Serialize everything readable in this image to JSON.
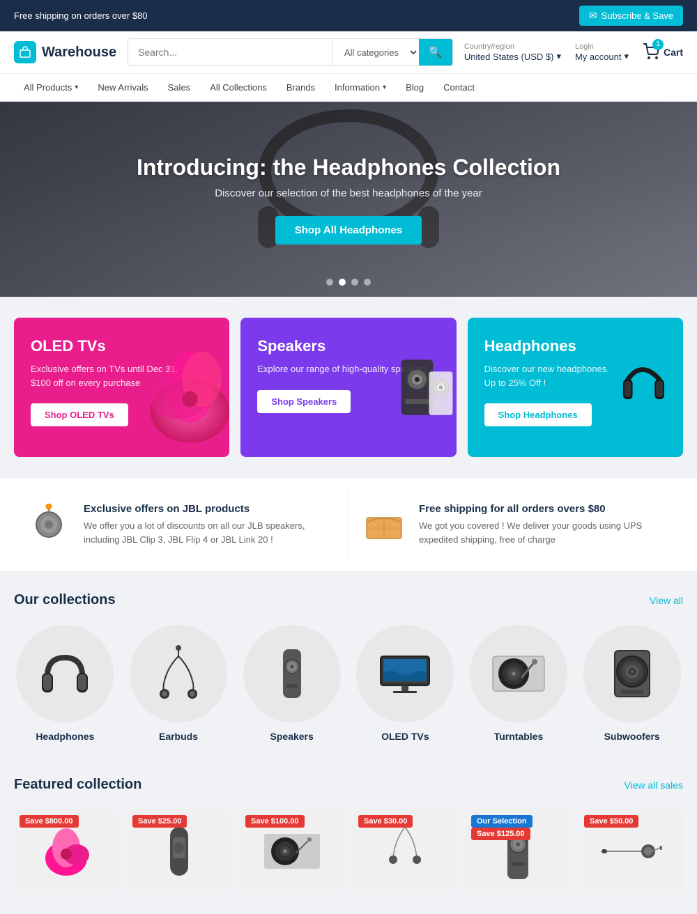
{
  "topbar": {
    "shipping_text": "Free shipping on orders over $80",
    "subscribe_label": "Subscribe & Save"
  },
  "header": {
    "logo_text": "Warehouse",
    "search_placeholder": "Search...",
    "search_category_label": "All categories",
    "country_label": "Country/region",
    "country_value": "United States (USD $)",
    "login_label": "Login",
    "account_label": "My account",
    "cart_count": "1",
    "cart_label": "Cart"
  },
  "nav": {
    "items": [
      {
        "label": "All Products",
        "has_dropdown": true
      },
      {
        "label": "New Arrivals",
        "has_dropdown": false
      },
      {
        "label": "Sales",
        "has_dropdown": false
      },
      {
        "label": "All Collections",
        "has_dropdown": false
      },
      {
        "label": "Brands",
        "has_dropdown": false
      },
      {
        "label": "Information",
        "has_dropdown": true
      },
      {
        "label": "Blog",
        "has_dropdown": false
      },
      {
        "label": "Contact",
        "has_dropdown": false
      }
    ]
  },
  "hero": {
    "title": "Introducing: the Headphones Collection",
    "subtitle": "Discover our selection of the best headphones of the year",
    "cta_label": "Shop All Headphones",
    "dots": [
      1,
      2,
      3,
      4
    ],
    "active_dot": 2
  },
  "promo_cards": [
    {
      "id": "oled",
      "theme": "pink",
      "title": "OLED TVs",
      "description": "Exclusive offers on TVs until Dec 31.\n$100 off on every purchase",
      "btn_label": "Shop OLED TVs"
    },
    {
      "id": "speakers",
      "theme": "purple",
      "title": "Speakers",
      "description": "Explore our range of high-quality speakers.",
      "btn_label": "Shop Speakers"
    },
    {
      "id": "headphones",
      "theme": "cyan",
      "title": "Headphones",
      "description": "Discover our new headphones.\nUp to 25% Off !",
      "btn_label": "Shop Headphones"
    }
  ],
  "info_banners": [
    {
      "id": "jbl",
      "icon": "🔊",
      "title": "Exclusive offers on JBL products",
      "description": "We offer you a lot of discounts on all our JLB speakers, including JBL Clip 3, JBL Flip 4 or JBL Link 20 !"
    },
    {
      "id": "shipping",
      "icon": "📦",
      "title": "Free shipping for all orders overs $80",
      "description": "We got you covered ! We deliver your goods using UPS expedited shipping, free of charge"
    }
  ],
  "collections": {
    "title": "Our collections",
    "view_all_label": "View all",
    "items": [
      {
        "id": "headphones",
        "label": "Headphones",
        "icon": "🎧"
      },
      {
        "id": "earbuds",
        "label": "Earbuds",
        "icon": "🎵"
      },
      {
        "id": "speakers",
        "label": "Speakers",
        "icon": "🔊"
      },
      {
        "id": "oled-tvs",
        "label": "OLED TVs",
        "icon": "📺"
      },
      {
        "id": "turntables",
        "label": "Turntables",
        "icon": "💿"
      },
      {
        "id": "subwoofers",
        "label": "Subwoofers",
        "icon": "🔉"
      }
    ]
  },
  "featured": {
    "title": "Featured collection",
    "view_all_label": "View all sales",
    "products": [
      {
        "id": "p1",
        "badge_text": "Save $800.00",
        "badge_type": "red"
      },
      {
        "id": "p2",
        "badge_text": "Save $25.00",
        "badge_type": "red"
      },
      {
        "id": "p3",
        "badge_text": "Save $100.00",
        "badge_type": "red"
      },
      {
        "id": "p4",
        "badge_text": "Save $30.00",
        "badge_type": "red"
      },
      {
        "id": "p5",
        "badge_text": "Our Selection",
        "badge_type": "blue",
        "badge2_text": "Save $125.00",
        "badge2_type": "red"
      },
      {
        "id": "p6",
        "badge_text": "Save $50.00",
        "badge_type": "red"
      }
    ]
  }
}
